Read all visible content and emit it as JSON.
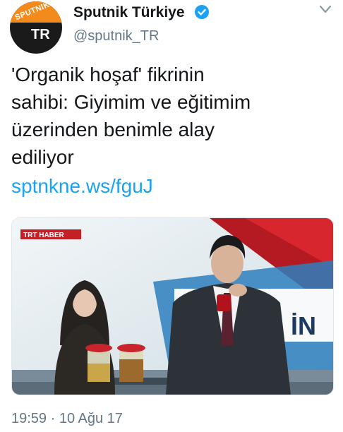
{
  "header": {
    "display_name": "Sputnik Türkiye",
    "handle": "@sputnik_TR",
    "avatar_brand": "SPUTNIK",
    "avatar_sub": "TR",
    "verified_icon": "verified-badge-icon",
    "menu_icon": "chevron-down-icon"
  },
  "tweet": {
    "lines": [
      "'Organik hoşaf' fikrinin",
      "sahibi: Giyimim ve eğitimim",
      "üzerinden benimle alay",
      "ediliyor"
    ],
    "link": "sptnkne.ws/fguJ"
  },
  "media": {
    "channel_logo": "TRT HABER",
    "backdrop_text": "İN"
  },
  "footer": {
    "timestamp": "19:59 · 10 Ağu 17"
  },
  "colors": {
    "link": "#1da1f2",
    "secondary": "#657786",
    "brand_orange": "#f28b1c",
    "verified": "#1da1f2"
  }
}
